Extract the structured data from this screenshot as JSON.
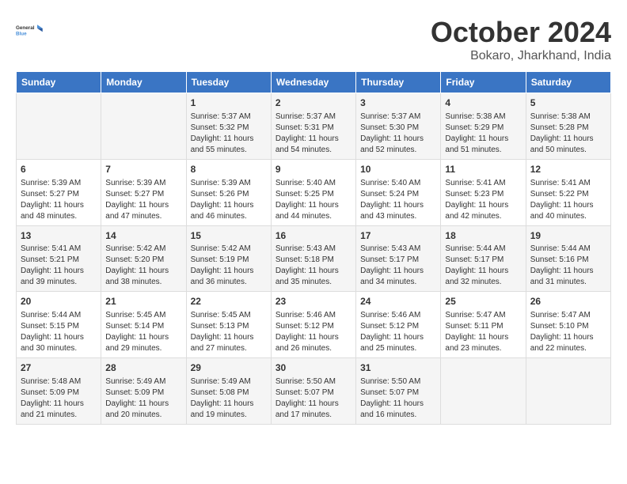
{
  "header": {
    "logo_general": "General",
    "logo_blue": "Blue",
    "month": "October 2024",
    "location": "Bokaro, Jharkhand, India"
  },
  "columns": [
    "Sunday",
    "Monday",
    "Tuesday",
    "Wednesday",
    "Thursday",
    "Friday",
    "Saturday"
  ],
  "weeks": [
    [
      {
        "day": "",
        "info": ""
      },
      {
        "day": "",
        "info": ""
      },
      {
        "day": "1",
        "info": "Sunrise: 5:37 AM\nSunset: 5:32 PM\nDaylight: 11 hours and 55 minutes."
      },
      {
        "day": "2",
        "info": "Sunrise: 5:37 AM\nSunset: 5:31 PM\nDaylight: 11 hours and 54 minutes."
      },
      {
        "day": "3",
        "info": "Sunrise: 5:37 AM\nSunset: 5:30 PM\nDaylight: 11 hours and 52 minutes."
      },
      {
        "day": "4",
        "info": "Sunrise: 5:38 AM\nSunset: 5:29 PM\nDaylight: 11 hours and 51 minutes."
      },
      {
        "day": "5",
        "info": "Sunrise: 5:38 AM\nSunset: 5:28 PM\nDaylight: 11 hours and 50 minutes."
      }
    ],
    [
      {
        "day": "6",
        "info": "Sunrise: 5:39 AM\nSunset: 5:27 PM\nDaylight: 11 hours and 48 minutes."
      },
      {
        "day": "7",
        "info": "Sunrise: 5:39 AM\nSunset: 5:27 PM\nDaylight: 11 hours and 47 minutes."
      },
      {
        "day": "8",
        "info": "Sunrise: 5:39 AM\nSunset: 5:26 PM\nDaylight: 11 hours and 46 minutes."
      },
      {
        "day": "9",
        "info": "Sunrise: 5:40 AM\nSunset: 5:25 PM\nDaylight: 11 hours and 44 minutes."
      },
      {
        "day": "10",
        "info": "Sunrise: 5:40 AM\nSunset: 5:24 PM\nDaylight: 11 hours and 43 minutes."
      },
      {
        "day": "11",
        "info": "Sunrise: 5:41 AM\nSunset: 5:23 PM\nDaylight: 11 hours and 42 minutes."
      },
      {
        "day": "12",
        "info": "Sunrise: 5:41 AM\nSunset: 5:22 PM\nDaylight: 11 hours and 40 minutes."
      }
    ],
    [
      {
        "day": "13",
        "info": "Sunrise: 5:41 AM\nSunset: 5:21 PM\nDaylight: 11 hours and 39 minutes."
      },
      {
        "day": "14",
        "info": "Sunrise: 5:42 AM\nSunset: 5:20 PM\nDaylight: 11 hours and 38 minutes."
      },
      {
        "day": "15",
        "info": "Sunrise: 5:42 AM\nSunset: 5:19 PM\nDaylight: 11 hours and 36 minutes."
      },
      {
        "day": "16",
        "info": "Sunrise: 5:43 AM\nSunset: 5:18 PM\nDaylight: 11 hours and 35 minutes."
      },
      {
        "day": "17",
        "info": "Sunrise: 5:43 AM\nSunset: 5:17 PM\nDaylight: 11 hours and 34 minutes."
      },
      {
        "day": "18",
        "info": "Sunrise: 5:44 AM\nSunset: 5:17 PM\nDaylight: 11 hours and 32 minutes."
      },
      {
        "day": "19",
        "info": "Sunrise: 5:44 AM\nSunset: 5:16 PM\nDaylight: 11 hours and 31 minutes."
      }
    ],
    [
      {
        "day": "20",
        "info": "Sunrise: 5:44 AM\nSunset: 5:15 PM\nDaylight: 11 hours and 30 minutes."
      },
      {
        "day": "21",
        "info": "Sunrise: 5:45 AM\nSunset: 5:14 PM\nDaylight: 11 hours and 29 minutes."
      },
      {
        "day": "22",
        "info": "Sunrise: 5:45 AM\nSunset: 5:13 PM\nDaylight: 11 hours and 27 minutes."
      },
      {
        "day": "23",
        "info": "Sunrise: 5:46 AM\nSunset: 5:12 PM\nDaylight: 11 hours and 26 minutes."
      },
      {
        "day": "24",
        "info": "Sunrise: 5:46 AM\nSunset: 5:12 PM\nDaylight: 11 hours and 25 minutes."
      },
      {
        "day": "25",
        "info": "Sunrise: 5:47 AM\nSunset: 5:11 PM\nDaylight: 11 hours and 23 minutes."
      },
      {
        "day": "26",
        "info": "Sunrise: 5:47 AM\nSunset: 5:10 PM\nDaylight: 11 hours and 22 minutes."
      }
    ],
    [
      {
        "day": "27",
        "info": "Sunrise: 5:48 AM\nSunset: 5:09 PM\nDaylight: 11 hours and 21 minutes."
      },
      {
        "day": "28",
        "info": "Sunrise: 5:49 AM\nSunset: 5:09 PM\nDaylight: 11 hours and 20 minutes."
      },
      {
        "day": "29",
        "info": "Sunrise: 5:49 AM\nSunset: 5:08 PM\nDaylight: 11 hours and 19 minutes."
      },
      {
        "day": "30",
        "info": "Sunrise: 5:50 AM\nSunset: 5:07 PM\nDaylight: 11 hours and 17 minutes."
      },
      {
        "day": "31",
        "info": "Sunrise: 5:50 AM\nSunset: 5:07 PM\nDaylight: 11 hours and 16 minutes."
      },
      {
        "day": "",
        "info": ""
      },
      {
        "day": "",
        "info": ""
      }
    ]
  ]
}
